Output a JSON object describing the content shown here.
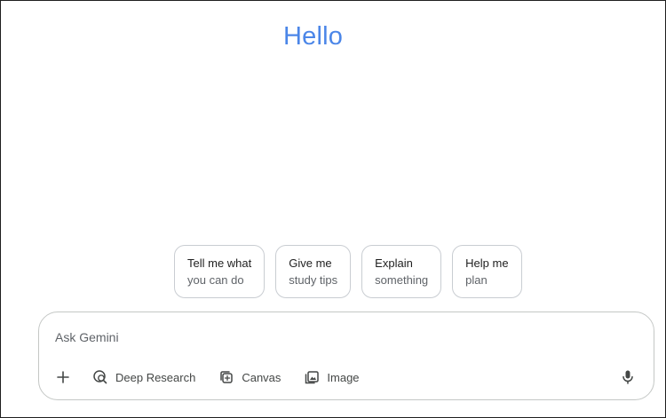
{
  "greeting": "Hello",
  "suggestions": [
    {
      "line1": "Tell me what",
      "line2": "you can do"
    },
    {
      "line1": "Give me",
      "line2": "study tips"
    },
    {
      "line1": "Explain",
      "line2": "something"
    },
    {
      "line1": "Help me",
      "line2": "plan"
    }
  ],
  "composer": {
    "placeholder": "Ask Gemini",
    "value": ""
  },
  "tools": {
    "add_icon": "plus-icon",
    "deep_research": {
      "label": "Deep Research",
      "icon": "deep-research-icon"
    },
    "canvas": {
      "label": "Canvas",
      "icon": "canvas-icon"
    },
    "image": {
      "label": "Image",
      "icon": "image-gallery-icon"
    },
    "mic_icon": "microphone-icon"
  },
  "colors": {
    "greeting": "#4b86e8",
    "chip_border": "#c9cdd2",
    "composer_border": "#c4c7c5",
    "icon": "#444746"
  }
}
